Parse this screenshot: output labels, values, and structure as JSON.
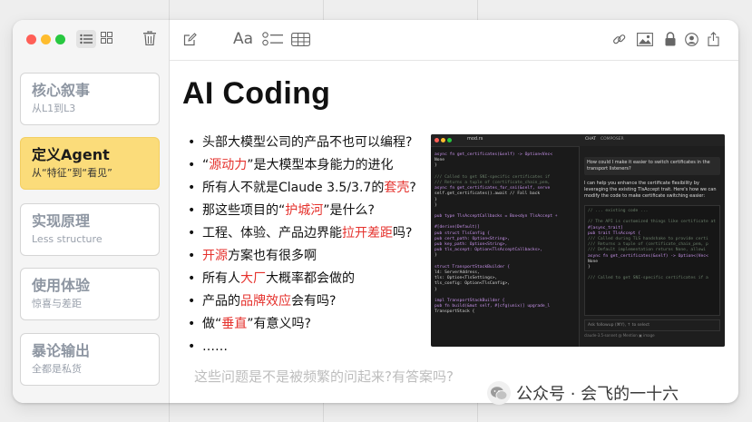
{
  "window": {
    "traffic_lights": [
      "#ff5f57",
      "#febc2e",
      "#28c840"
    ],
    "sidebar_toolbar": {
      "icons": [
        "list-view-icon",
        "grid-view-icon",
        "trash-icon"
      ]
    },
    "main_toolbar": {
      "compose_icon": "compose-icon",
      "format_label": "Aa",
      "icons": [
        "checklist-icon",
        "table-icon",
        "link-icon",
        "image-icon",
        "lock-icon",
        "share-person-icon",
        "share-icon"
      ]
    }
  },
  "sidebar": {
    "notes": [
      {
        "title": "核心叙事",
        "subtitle": "从L1到L3"
      },
      {
        "title": "定义Agent",
        "subtitle": "从“特征”到“看见”"
      },
      {
        "title": "实现原理",
        "subtitle": "Less structure"
      },
      {
        "title": "使用体验",
        "subtitle": "惊喜与差距"
      },
      {
        "title": "暴论输出",
        "subtitle": "全都是私货"
      }
    ],
    "selected_index": 1
  },
  "document": {
    "title": "AI Coding",
    "bullet_symbol": "•",
    "bullets": [
      {
        "parts": [
          "头部大模型公司的产品不也可以编程?"
        ]
      },
      {
        "parts": [
          "“",
          "源动力",
          "”是大模型本身能力的进化"
        ]
      },
      {
        "parts": [
          "所有人不就是Claude 3.5/3.7的",
          "套壳",
          "?"
        ]
      },
      {
        "parts": [
          "那这些项目的“",
          "护城河",
          "”是什么?"
        ]
      },
      {
        "parts": [
          "工程、体验、产品边界能",
          "拉开差距",
          "吗?"
        ]
      },
      {
        "parts": [
          "",
          "开源",
          "方案也有很多啊"
        ]
      },
      {
        "parts": [
          "所有人",
          "大厂",
          "大概率都会做的"
        ]
      },
      {
        "parts": [
          "产品的",
          "品牌效应",
          "会有吗?"
        ]
      },
      {
        "parts": [
          "做“",
          "垂直",
          "”有意义吗?"
        ]
      },
      {
        "parts": [
          "……"
        ]
      }
    ],
    "bottom_question": "这些问题是不是被频繁的问起来?有答案吗?"
  },
  "embedded_screenshot": {
    "file_tab": "mod.rs",
    "chat_tabs": [
      "CHAT",
      "COMPOSER"
    ],
    "chat_question": "How could I make it easier to switch certificates in the transport listeners?",
    "chat_answer": "I can help you enhance the certificate flexibility by leveraging the existing TlsAccept trait. Here's how we can modify the code to make certificate switching easier:",
    "code_lines": [
      "async fn get_certificates(&self) -> Option<Vec<",
      "    None",
      "}",
      "",
      "/// Called to get SNI-specific certificates if",
      "/// Returns a tuple of (certificate_chain_pem,",
      "async fn get_certificates_for_sni(&self, serve",
      "    self.get_certificates().await // Fall back",
      "}",
      "}",
      "",
      "pub type TlsAcceptCallbacks = Box<dyn TlsAccept +",
      "",
      "#[derive(Default)]",
      "pub struct TlsConfig {",
      "    pub cert_path: Option<String>,",
      "    pub key_path: Option<String>,",
      "    pub tls_accept: Option<TlsAcceptCallbacks>,",
      "}",
      "",
      "struct TransportStackBuilder {",
      "    l4: ServerAddress,",
      "    tls: Option<TlsSettings>,",
      "    tls_config: Option<TlsConfig>,",
      "}",
      "",
      "impl TransportStackBuilder {",
      "    pub fn build(&mut self, #[cfg(unix)] upgrade_l",
      "        TransportStack {"
    ],
    "chat_code_lines": [
      "// ... existing code ...",
      "",
      "// The API is customized things like certificate at",
      "#[async_trait]",
      "pub trait TlsAccept {",
      "    /// Called during TLS handshake to provide certi",
      "    /// Returns a tuple of (certificate_chain_pem, p",
      "    /// Default implementation returns None, allowi",
      "    async fn get_certificates(&self) -> Option<(Vec<",
      "        None",
      "    }",
      "",
      "    /// Called to get SNI-specific certificates if a"
    ],
    "chat_input_placeholder": "Ask followup (⌘Y), ↑ to select",
    "chat_footer": "claude-3.5-sonnet   @ Mention   ▣ image"
  },
  "watermark": {
    "text": "公众号 · 会飞的一十六"
  }
}
